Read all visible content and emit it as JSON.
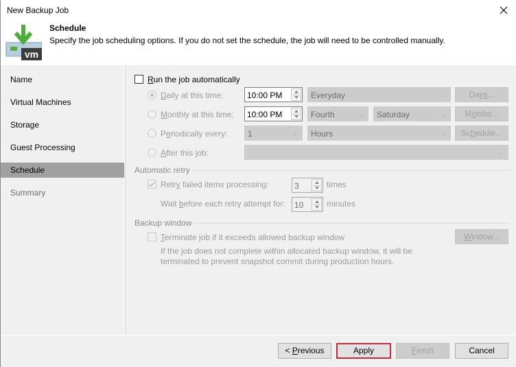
{
  "window": {
    "title": "New Backup Job",
    "close_icon": "close-icon"
  },
  "header": {
    "icon": "vm-backup-download-icon",
    "icon_badge": "vm",
    "title": "Schedule",
    "description": "Specify the job scheduling options. If you do not set the schedule, the job will need to be controlled manually."
  },
  "sidebar": {
    "items": [
      {
        "label": "Name",
        "state": "normal"
      },
      {
        "label": "Virtual Machines",
        "state": "normal"
      },
      {
        "label": "Storage",
        "state": "normal"
      },
      {
        "label": "Guest Processing",
        "state": "normal"
      },
      {
        "label": "Schedule",
        "state": "active"
      },
      {
        "label": "Summary",
        "state": "dim"
      }
    ]
  },
  "schedule": {
    "run_auto": {
      "label_u": "R",
      "label_rest": "un the job automatically",
      "checked": false
    },
    "daily": {
      "label_u": "D",
      "label_rest": "aily at this time:",
      "selected": true,
      "time": "10:00 PM",
      "select": "Everyday",
      "button_pre": "Day",
      "button_u": "s",
      "button_post": "..."
    },
    "monthly": {
      "label_u": "M",
      "label_rest": "onthly at this time:",
      "selected": false,
      "time": "10:00 PM",
      "ordinal": "Fourth",
      "weekday": "Saturday",
      "button_pre": "M",
      "button_u": "o",
      "button_post": "nths..."
    },
    "periodically": {
      "label_pre": "P",
      "label_u": "e",
      "label_rest": "riodically every:",
      "selected": false,
      "value": "1",
      "unit": "Hours",
      "button_pre": "Sc",
      "button_u": "h",
      "button_post": "edule..."
    },
    "after": {
      "label_u": "A",
      "label_rest": "fter this job:",
      "selected": false,
      "value": ""
    }
  },
  "retry": {
    "group_label": "Automatic retry",
    "retry_label_pre": "Retr",
    "retry_label_u": "y",
    "retry_label_post": " failed items processing:",
    "retry_checked": true,
    "retry_count": "3",
    "retry_unit": "times",
    "wait_label_pre": "Wait ",
    "wait_label_u": "b",
    "wait_label_post": "efore each retry attempt for:",
    "wait_value": "10",
    "wait_unit": "minutes"
  },
  "backup_window": {
    "group_label": "Backup window",
    "terminate_u": "T",
    "terminate_rest": "erminate job if it exceeds allowed backup window",
    "terminate_checked": false,
    "note_line1": "If the job does not complete within allocated backup window, it will be",
    "note_line2": "terminated to prevent snapshot commit during production hours.",
    "button_u": "W",
    "button_rest": "indow..."
  },
  "footer": {
    "previous_pre": "< ",
    "previous_u": "P",
    "previous_rest": "revious",
    "apply": "Apply",
    "finish_u": "F",
    "finish_rest": "inish",
    "cancel": "Cancel",
    "highlight_color": "#c42b3a"
  }
}
